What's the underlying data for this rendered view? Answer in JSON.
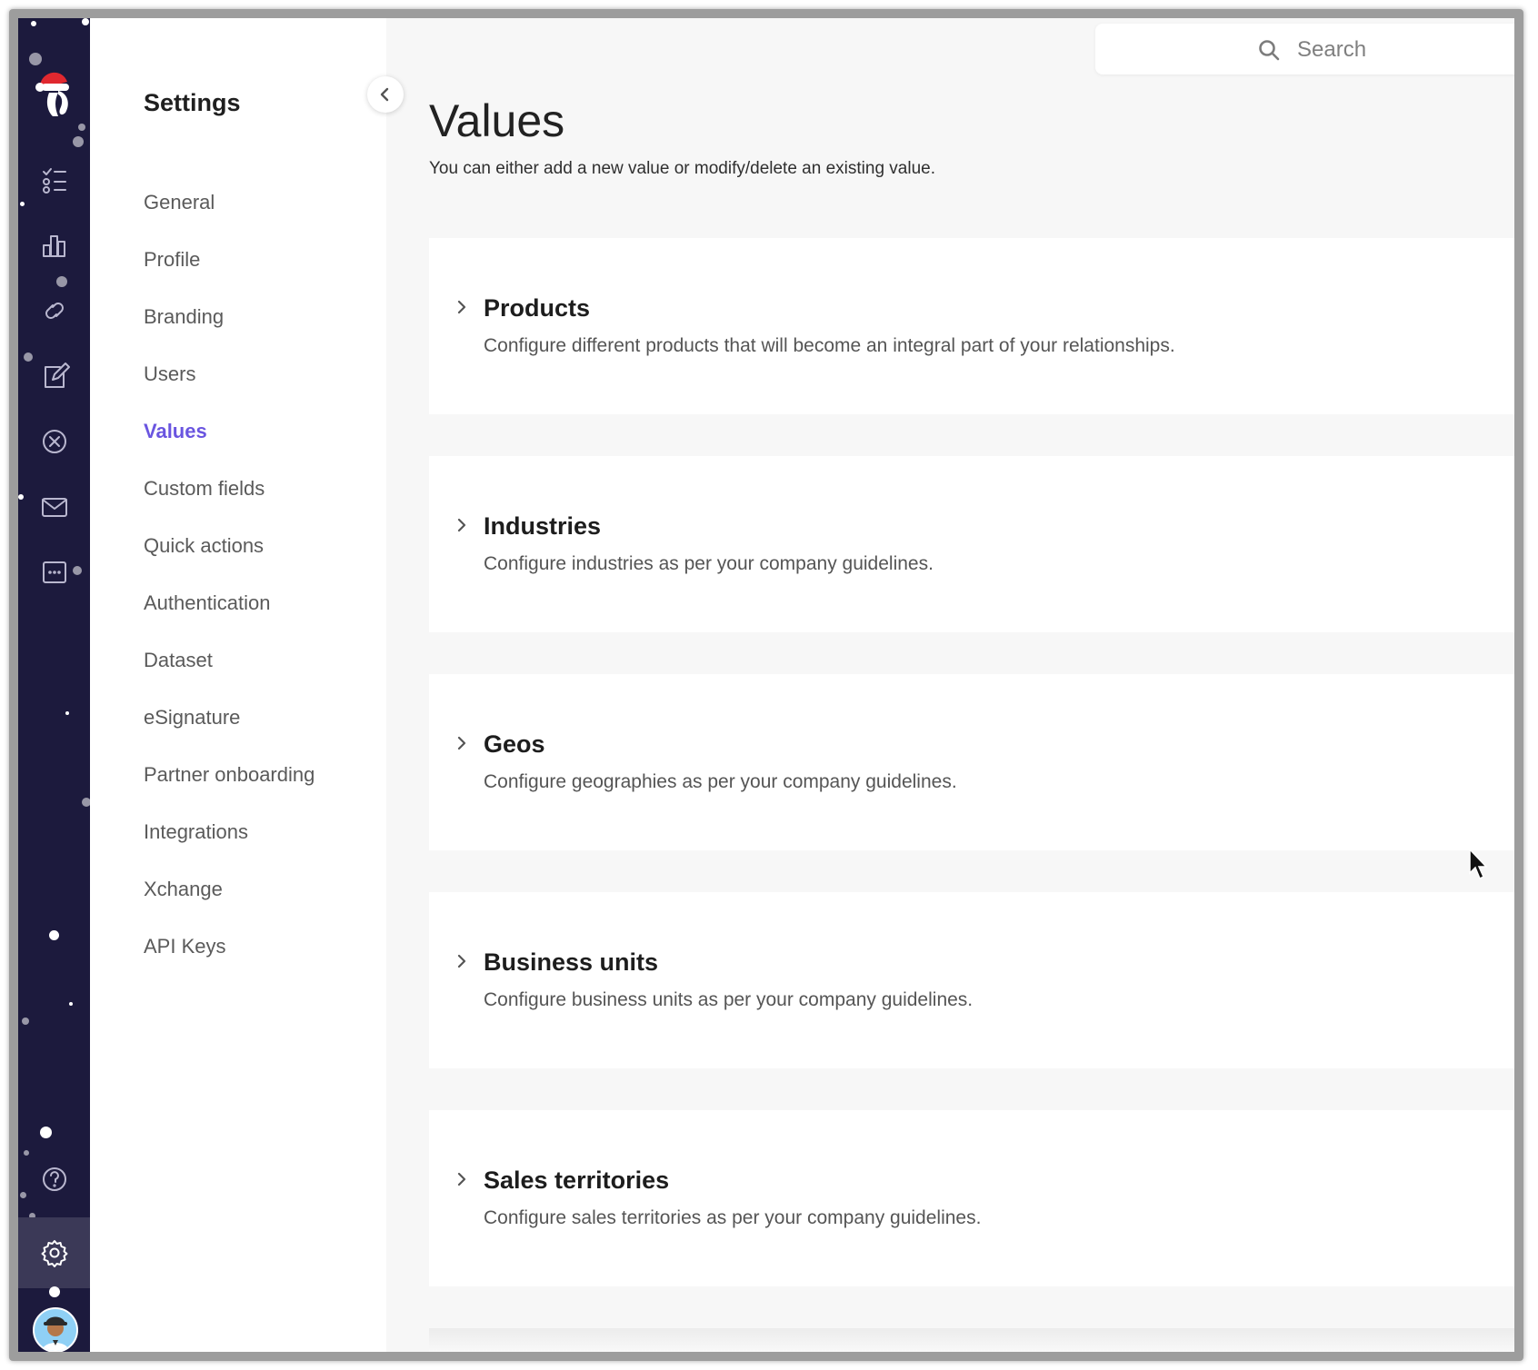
{
  "settings": {
    "title": "Settings",
    "nav": [
      "General",
      "Profile",
      "Branding",
      "Users",
      "Values",
      "Custom fields",
      "Quick actions",
      "Authentication",
      "Dataset",
      "eSignature",
      "Partner onboarding",
      "Integrations",
      "Xchange",
      "API Keys"
    ],
    "active": "Values"
  },
  "search": {
    "placeholder": "Search"
  },
  "page": {
    "title": "Values",
    "subtitle": "You can either add a new value or modify/delete an existing value."
  },
  "cards": [
    {
      "title": "Products",
      "description": "Configure different products that will become an integral part of your relationships."
    },
    {
      "title": "Industries",
      "description": "Configure industries as per your company guidelines."
    },
    {
      "title": "Geos",
      "description": "Configure geographies as per your company guidelines."
    },
    {
      "title": "Business units",
      "description": "Configure business units as per your company guidelines."
    },
    {
      "title": "Sales territories",
      "description": "Configure sales territories as per your company guidelines."
    }
  ],
  "colors": {
    "rail": "#1c1a3d",
    "accent": "#6a55e0",
    "background": "#f7f7f7"
  },
  "rail_icons": [
    "checklist-icon",
    "bar-chart-icon",
    "link-icon",
    "edit-note-icon",
    "cancel-circle-icon",
    "mail-icon",
    "chat-dots-icon",
    "help-icon",
    "gear-icon"
  ]
}
